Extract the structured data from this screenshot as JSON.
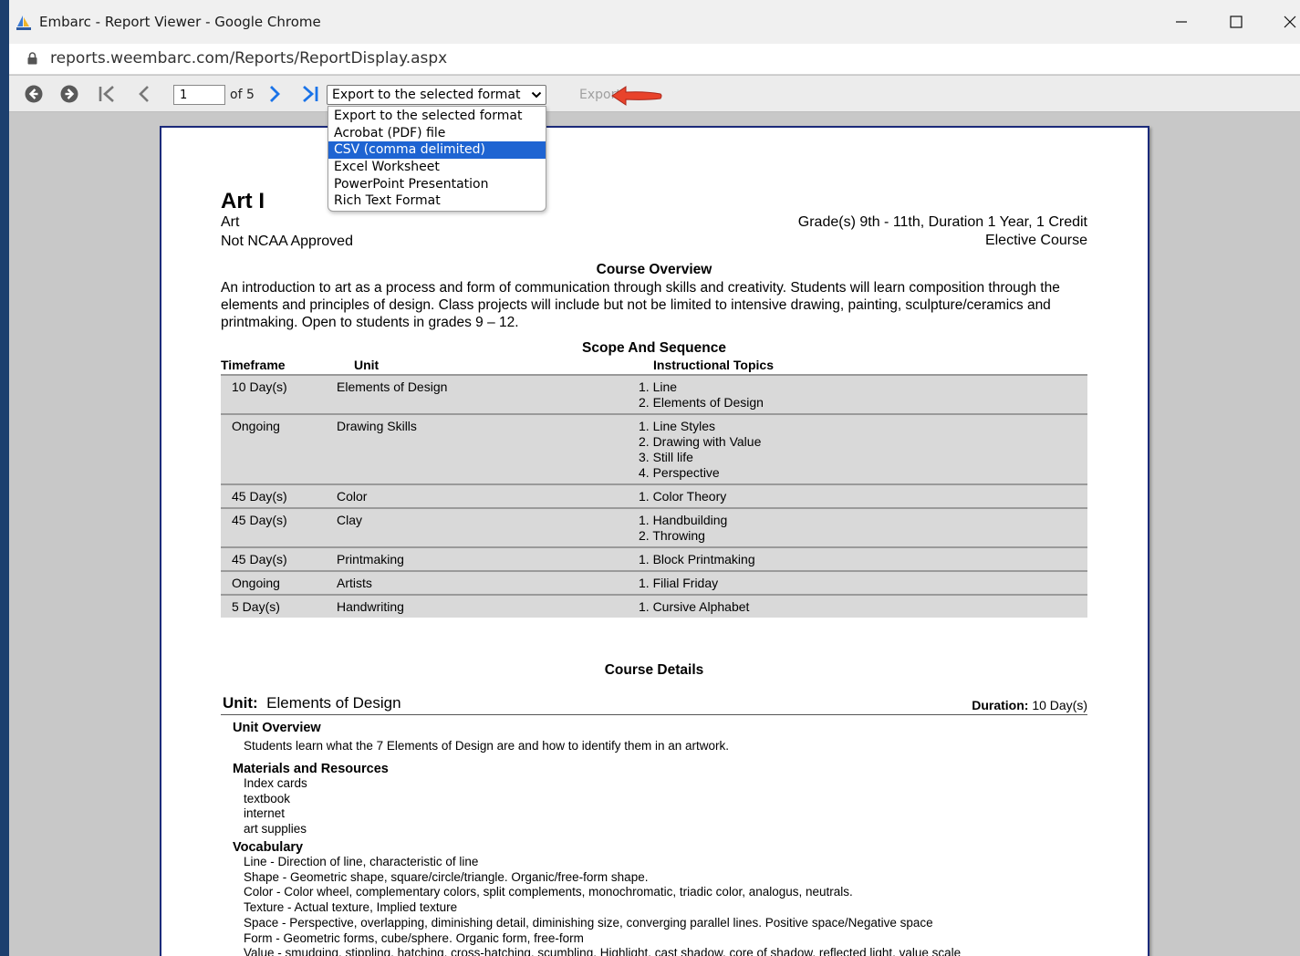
{
  "window": {
    "title": "Embarc - Report Viewer - Google Chrome",
    "controls": [
      "—",
      "☐",
      "✕"
    ]
  },
  "address_bar": {
    "url": "reports.weembarc.com/Reports/ReportDisplay.aspx"
  },
  "toolbar": {
    "page_value": "1",
    "of_pages": "of 5",
    "export_select_value": "Export to the selected format",
    "export_label": "Export",
    "accent_color": "#1e64d2",
    "arrow_color": "#e8432b"
  },
  "export_dropdown": {
    "options": [
      "Export to the selected format",
      "Acrobat (PDF) file",
      "CSV (comma delimited)",
      "Excel Worksheet",
      "PowerPoint Presentation",
      "Rich Text Format"
    ],
    "highlighted": "CSV (comma delimited)"
  },
  "report": {
    "title": "Art I",
    "subject": "Art",
    "ncaa": "Not NCAA Approved",
    "grades": "Grade(s) 9th - 11th, Duration 1 Year, 1 Credit",
    "course_type": "Elective Course",
    "overview_heading": "Course Overview",
    "overview_text": "An introduction to art as a process and form of communication through skills and creativity. Students will learn composition through the elements and principles of design. Class projects will include but not be limited to intensive drawing, painting, sculpture/ceramics and printmaking. Open to students in grades 9 – 12.",
    "scope_heading": "Scope And Sequence",
    "columns": [
      "Timeframe",
      "Unit",
      "Instructional Topics"
    ],
    "rows": [
      {
        "timeframe": "10 Day(s)",
        "unit": "Elements of Design",
        "topics": [
          "1. Line",
          "2. Elements of Design"
        ]
      },
      {
        "timeframe": "Ongoing",
        "unit": "Drawing Skills",
        "topics": [
          "1. Line Styles",
          "2. Drawing with Value",
          "3. Still life",
          "4. Perspective"
        ]
      },
      {
        "timeframe": "45 Day(s)",
        "unit": "Color",
        "topics": [
          "1. Color Theory"
        ]
      },
      {
        "timeframe": "45 Day(s)",
        "unit": "Clay",
        "topics": [
          "1. Handbuilding",
          "2. Throwing"
        ]
      },
      {
        "timeframe": "45 Day(s)",
        "unit": "Printmaking",
        "topics": [
          "1. Block Printmaking"
        ]
      },
      {
        "timeframe": "Ongoing",
        "unit": "Artists",
        "topics": [
          "1. Filial Friday"
        ]
      },
      {
        "timeframe": "5 Day(s)",
        "unit": "Handwriting",
        "topics": [
          "1. Cursive Alphabet"
        ]
      }
    ],
    "details_heading": "Course Details",
    "unit_label": "Unit:",
    "unit_name": "Elements of Design",
    "duration_label": "Duration:",
    "duration_value": "10 Day(s)",
    "unit_overview_heading": "Unit Overview",
    "unit_overview_text": "Students learn what the 7 Elements of Design are and how to identify them in an artwork.",
    "materials_heading": "Materials and Resources",
    "materials": [
      "Index cards",
      "textbook",
      "internet",
      "art supplies"
    ],
    "vocabulary_heading": "Vocabulary",
    "vocabulary": [
      "Line - Direction of line, characteristic of line",
      "Shape - Geometric shape, square/circle/triangle. Organic/free-form shape.",
      "Color - Color wheel, complementary colors, split complements, monochromatic, triadic color, analogus, neutrals.",
      "Texture - Actual texture, Implied texture",
      "Space - Perspective, overlapping, diminishing detail, diminishing size, converging parallel lines. Positive space/Negative space",
      "Form - Geometric forms, cube/sphere. Organic form, free-form",
      "Value - smudging, stippling, hatching, cross-hatching, scumbling, Highlight, cast shadow, core of shadow, reflected light, value scale"
    ]
  }
}
